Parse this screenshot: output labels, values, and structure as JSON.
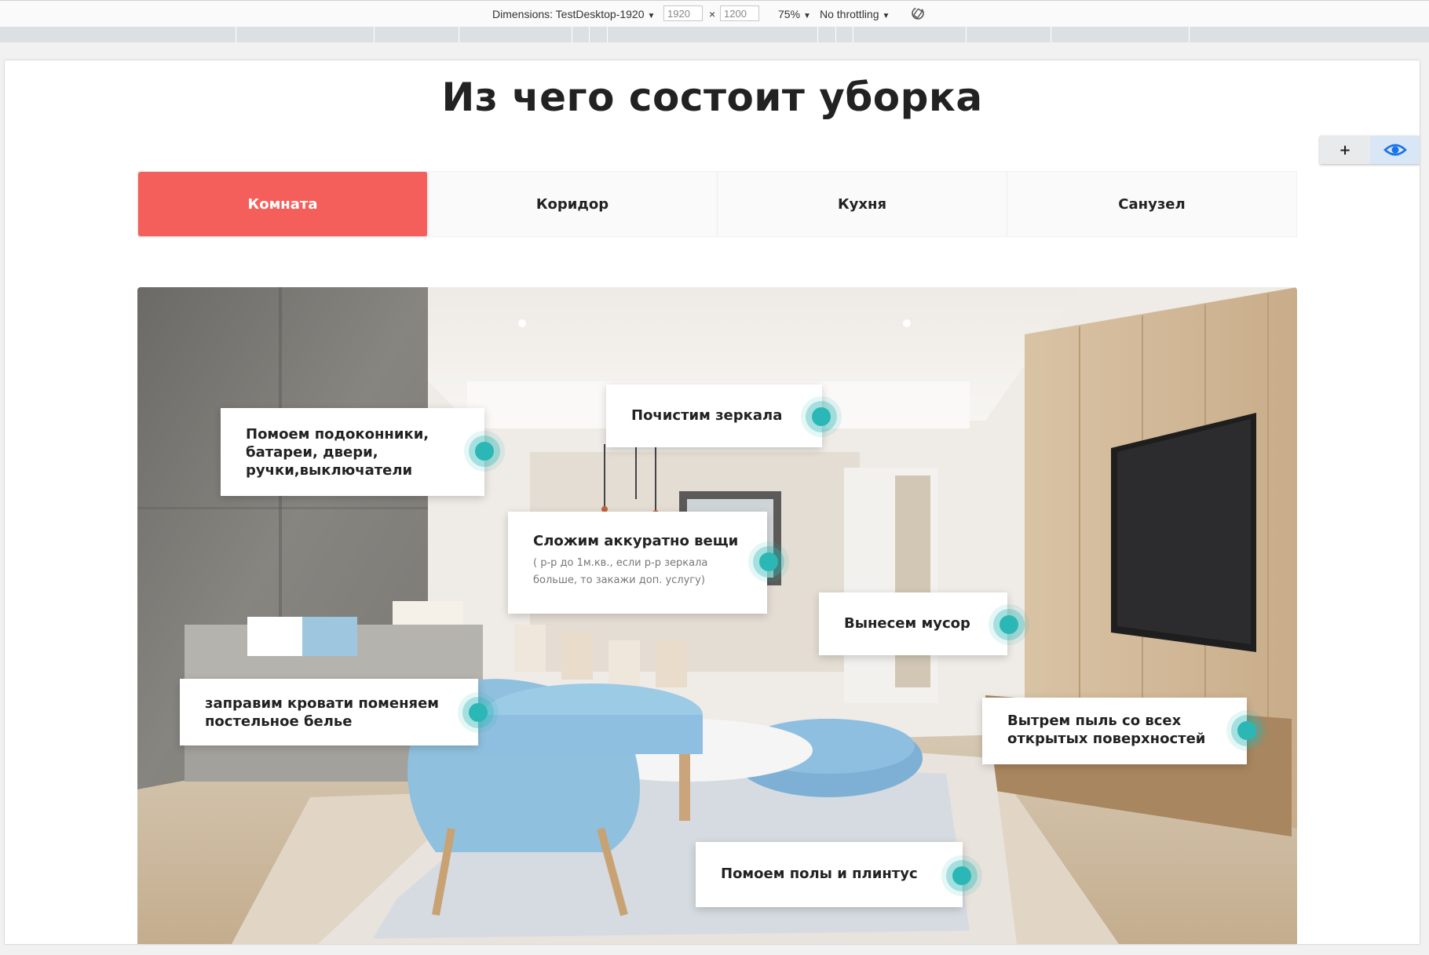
{
  "devtools": {
    "dimensions_label": "Dimensions: TestDesktop-1920",
    "width_value": "1920",
    "times_symbol": "×",
    "height_value": "1200",
    "zoom": "75%",
    "throttling": "No throttling",
    "rotate_icon": "rotate-icon"
  },
  "page": {
    "title": "Из чего состоит уборка",
    "tools": {
      "plus_label": "+",
      "eye_icon": "eye-icon",
      "eye_color": "#1a73e8"
    },
    "tabs": [
      {
        "label": "Комната",
        "active": true
      },
      {
        "label": "Коридор",
        "active": false
      },
      {
        "label": "Кухня",
        "active": false
      },
      {
        "label": "Санузел",
        "active": false
      }
    ],
    "accent_color": "#f45f5b",
    "dot_color": "#2bb7b5",
    "callouts": [
      {
        "text": "Помоем подоконники, батареи, двери, ручки,выключатели"
      },
      {
        "text": "Почистим зеркала"
      },
      {
        "text": "Сложим аккуратно вещи",
        "sub": "( р-р до 1м.кв., если р-р зеркала больше, то закажи доп. услугу)"
      },
      {
        "text": "Вынесем мусор"
      },
      {
        "text": "заправим кровати поменяем постельное белье"
      },
      {
        "text": "Вытрем пыль со всех открытых поверхностей"
      },
      {
        "text": "Помоем полы и плинтус"
      }
    ]
  }
}
